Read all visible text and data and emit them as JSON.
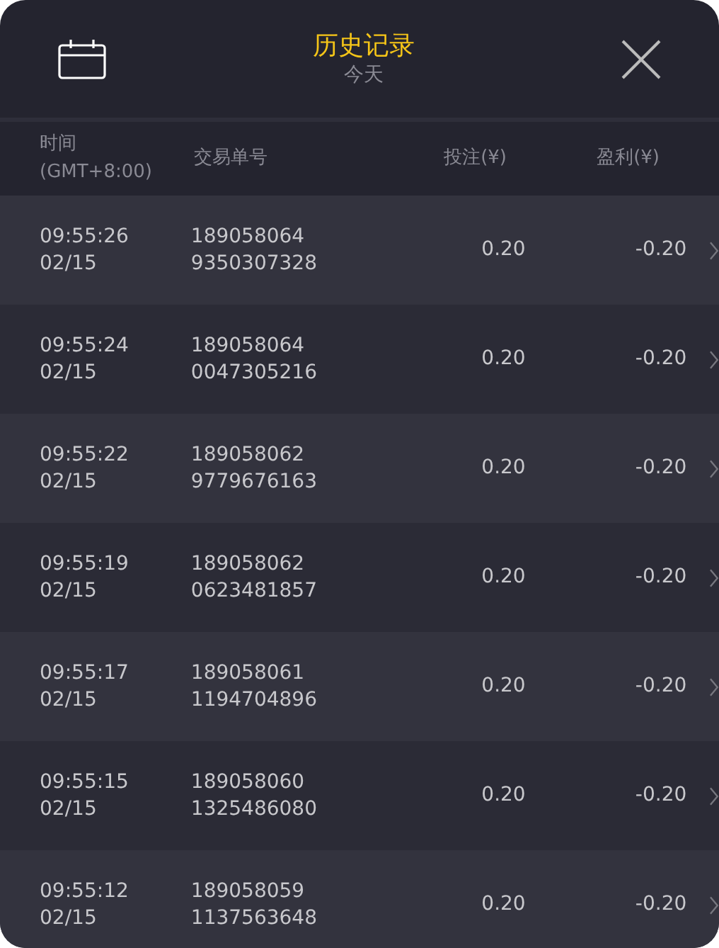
{
  "header": {
    "title": "历史记录",
    "subtitle": "今天"
  },
  "columns": [
    {
      "label": "时间",
      "sub": "(GMT+8:00)"
    },
    {
      "label": "交易单号"
    },
    {
      "label": "投注(¥)"
    },
    {
      "label": "盈利(¥)"
    }
  ],
  "rows": [
    {
      "time": "09:55:26",
      "date": "02/15",
      "order_no": [
        "189058064",
        "9350307328"
      ],
      "stake": "0.20",
      "profit": "-0.20"
    },
    {
      "time": "09:55:24",
      "date": "02/15",
      "order_no": [
        "189058064",
        "0047305216"
      ],
      "stake": "0.20",
      "profit": "-0.20"
    },
    {
      "time": "09:55:22",
      "date": "02/15",
      "order_no": [
        "189058062",
        "9779676163"
      ],
      "stake": "0.20",
      "profit": "-0.20"
    },
    {
      "time": "09:55:19",
      "date": "02/15",
      "order_no": [
        "189058062",
        "0623481857"
      ],
      "stake": "0.20",
      "profit": "-0.20"
    },
    {
      "time": "09:55:17",
      "date": "02/15",
      "order_no": [
        "189058061",
        "1194704896"
      ],
      "stake": "0.20",
      "profit": "-0.20"
    },
    {
      "time": "09:55:15",
      "date": "02/15",
      "order_no": [
        "189058060",
        "1325486080"
      ],
      "stake": "0.20",
      "profit": "-0.20"
    },
    {
      "time": "09:55:12",
      "date": "02/15",
      "order_no": [
        "189058059",
        "1137563648"
      ],
      "stake": "0.20",
      "profit": "-0.20"
    }
  ]
}
